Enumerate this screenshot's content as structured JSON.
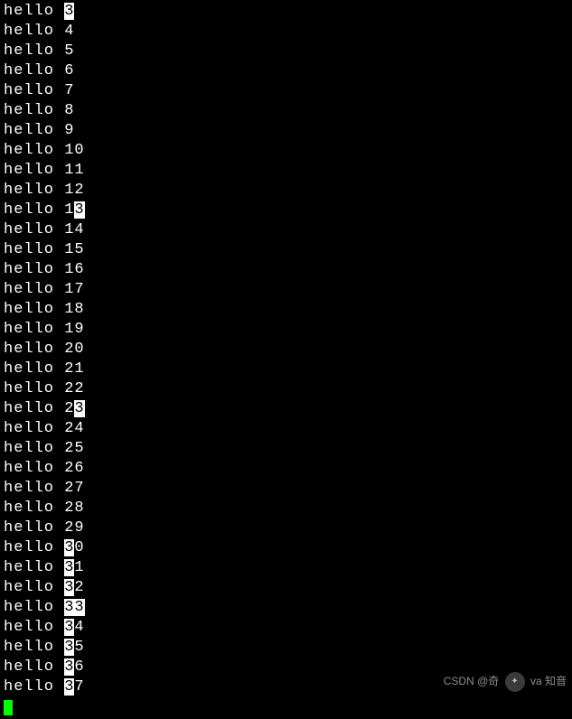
{
  "terminal": {
    "lines": [
      {
        "prefix": "hello ",
        "hl": "3",
        "suffix": ""
      },
      {
        "prefix": "hello 4",
        "hl": "",
        "suffix": ""
      },
      {
        "prefix": "hello 5",
        "hl": "",
        "suffix": ""
      },
      {
        "prefix": "hello 6",
        "hl": "",
        "suffix": ""
      },
      {
        "prefix": "hello 7",
        "hl": "",
        "suffix": ""
      },
      {
        "prefix": "hello 8",
        "hl": "",
        "suffix": ""
      },
      {
        "prefix": "hello 9",
        "hl": "",
        "suffix": ""
      },
      {
        "prefix": "hello 10",
        "hl": "",
        "suffix": ""
      },
      {
        "prefix": "hello 11",
        "hl": "",
        "suffix": ""
      },
      {
        "prefix": "hello 12",
        "hl": "",
        "suffix": ""
      },
      {
        "prefix": "hello 1",
        "hl": "3",
        "suffix": ""
      },
      {
        "prefix": "hello 14",
        "hl": "",
        "suffix": ""
      },
      {
        "prefix": "hello 15",
        "hl": "",
        "suffix": ""
      },
      {
        "prefix": "hello 16",
        "hl": "",
        "suffix": ""
      },
      {
        "prefix": "hello 17",
        "hl": "",
        "suffix": ""
      },
      {
        "prefix": "hello 18",
        "hl": "",
        "suffix": ""
      },
      {
        "prefix": "hello 19",
        "hl": "",
        "suffix": ""
      },
      {
        "prefix": "hello 20",
        "hl": "",
        "suffix": ""
      },
      {
        "prefix": "hello 21",
        "hl": "",
        "suffix": ""
      },
      {
        "prefix": "hello 22",
        "hl": "",
        "suffix": ""
      },
      {
        "prefix": "hello 2",
        "hl": "3",
        "suffix": ""
      },
      {
        "prefix": "hello 24",
        "hl": "",
        "suffix": ""
      },
      {
        "prefix": "hello 25",
        "hl": "",
        "suffix": ""
      },
      {
        "prefix": "hello 26",
        "hl": "",
        "suffix": ""
      },
      {
        "prefix": "hello 27",
        "hl": "",
        "suffix": ""
      },
      {
        "prefix": "hello 28",
        "hl": "",
        "suffix": ""
      },
      {
        "prefix": "hello 29",
        "hl": "",
        "suffix": ""
      },
      {
        "prefix": "hello ",
        "hl": "3",
        "suffix": "0"
      },
      {
        "prefix": "hello ",
        "hl": "3",
        "suffix": "1"
      },
      {
        "prefix": "hello ",
        "hl": "3",
        "suffix": "2"
      },
      {
        "prefix": "hello ",
        "hl": "33",
        "suffix": ""
      },
      {
        "prefix": "hello ",
        "hl": "3",
        "suffix": "4"
      },
      {
        "prefix": "hello ",
        "hl": "3",
        "suffix": "5"
      },
      {
        "prefix": "hello ",
        "hl": "3",
        "suffix": "6"
      },
      {
        "prefix": "hello ",
        "hl": "3",
        "suffix": "7"
      }
    ]
  },
  "watermark": {
    "left": "CSDN @奇",
    "mid": "va",
    "right": "知音"
  }
}
